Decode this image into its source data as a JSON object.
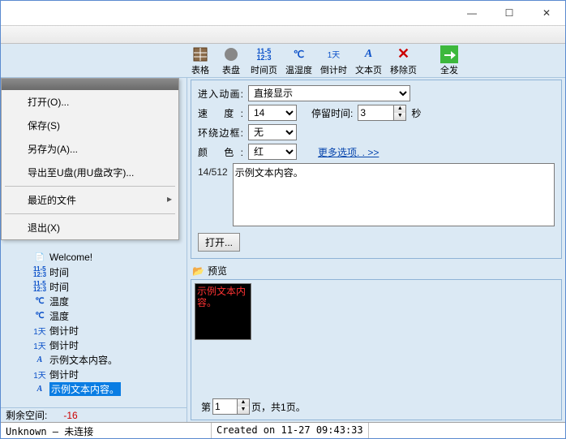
{
  "titlebar": {
    "min": "—",
    "max": "☐",
    "close": "✕"
  },
  "toolbar": {
    "table": "表格",
    "dial": "表盘",
    "timepage": "时间页",
    "temphum": "温湿度",
    "countdown": "倒计时",
    "textpage": "文本页",
    "removepage": "移除页",
    "sendall": "全发"
  },
  "menu": {
    "open": "打开(O)...",
    "save": "保存(S)",
    "saveas": "另存为(A)...",
    "export": "导出至U盘(用U盘改字)...",
    "recent": "最近的文件",
    "exit": "退出(X)"
  },
  "tree": {
    "items": [
      {
        "icon": "doc",
        "label": "Welcome!"
      },
      {
        "icon": "time",
        "label": "时间"
      },
      {
        "icon": "time",
        "label": "时间"
      },
      {
        "icon": "temp",
        "label": "温度"
      },
      {
        "icon": "temp",
        "label": "温度"
      },
      {
        "icon": "day",
        "label": "倒计时"
      },
      {
        "icon": "day",
        "label": "倒计时"
      },
      {
        "icon": "text",
        "label": "示例文本内容。"
      },
      {
        "icon": "day",
        "label": "倒计时"
      },
      {
        "icon": "text",
        "label": "示例文本内容。",
        "selected": true
      }
    ]
  },
  "form": {
    "enter_anim_label": "进入动画:",
    "enter_anim_value": "直接显示",
    "speed_label": "速    度:",
    "speed_value": "14",
    "stay_label": "停留时间:",
    "stay_value": "3",
    "stay_unit": "秒",
    "border_label": "环绕边框:",
    "border_value": "无",
    "color_label": "颜    色:",
    "color_value": "红",
    "more_options": "更多选项. . >>",
    "counter": "14/512",
    "text_content": "示例文本内容。",
    "open_btn": "打开..."
  },
  "preview": {
    "header": "预览",
    "led_text": "示例文本内容。",
    "page_prefix": "第",
    "page_num": "1",
    "page_suffix": "页，共1页。"
  },
  "leftfoot": {
    "label": "剩余空间:",
    "value": "-16"
  },
  "status": {
    "left": "Unknown — 未连接",
    "right": "Created on 11-27 09:43:33"
  },
  "icons": {
    "time_mini": "11-5\n12:3",
    "day_mini": "1天"
  }
}
